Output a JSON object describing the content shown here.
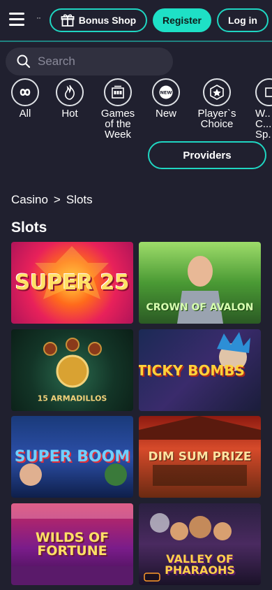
{
  "header": {
    "dots": "··",
    "bonus_shop": "Bonus Shop",
    "register": "Register",
    "login": "Log in"
  },
  "search": {
    "placeholder": "Search"
  },
  "categories": [
    {
      "label": "All",
      "icon": "infinity-icon"
    },
    {
      "label": "Hot",
      "icon": "flame-icon"
    },
    {
      "label": "Games of the Week",
      "icon": "slot-machine-icon"
    },
    {
      "label": "New",
      "icon": "new-badge-icon"
    },
    {
      "label": "Player`s Choice",
      "icon": "star-badge-icon"
    },
    {
      "label": "W... C... Sp...",
      "icon": "partial-icon"
    }
  ],
  "providers": "Providers",
  "breadcrumb": {
    "home": "Casino",
    "separator": ">",
    "current": "Slots"
  },
  "page_title": "Slots",
  "games": [
    {
      "title": "Super 25"
    },
    {
      "title": "Crown of Avalon"
    },
    {
      "title": "15 Armadillos"
    },
    {
      "title": "Sticky Bombs"
    },
    {
      "title": "Super Boom"
    },
    {
      "title": "Dim Sum Prize"
    },
    {
      "title": "Wilds of Fortune"
    },
    {
      "title": "Valley of Pharaohs"
    }
  ],
  "colors": {
    "accent": "#1fd6c2",
    "background": "#20202f",
    "search_bg": "#30303f"
  }
}
